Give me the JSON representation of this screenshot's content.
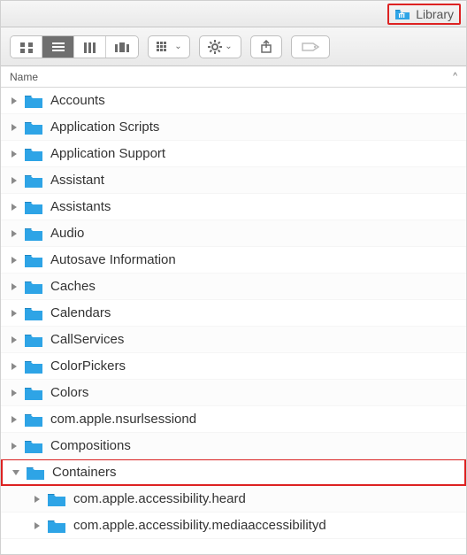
{
  "title": {
    "label": "Library",
    "icon": "library-folder-icon"
  },
  "toolbar": {
    "view_icon_label": "Icon View",
    "view_list_label": "List View",
    "view_column_label": "Column View",
    "view_coverflow_label": "Cover Flow View",
    "arrange_label": "Arrange",
    "action_label": "Action",
    "share_label": "Share",
    "tags_label": "Edit Tags"
  },
  "columns": {
    "name_label": "Name",
    "sort_indicator": "^"
  },
  "colors": {
    "folder": "#2ea4e6",
    "highlight": "#d22222",
    "toolbar_icon": "#6a6a6a",
    "active_bg": "#6f6f6f"
  },
  "rows": [
    {
      "label": "Accounts",
      "depth": 0,
      "expanded": false,
      "highlight": false
    },
    {
      "label": "Application Scripts",
      "depth": 0,
      "expanded": false,
      "highlight": false
    },
    {
      "label": "Application Support",
      "depth": 0,
      "expanded": false,
      "highlight": false
    },
    {
      "label": "Assistant",
      "depth": 0,
      "expanded": false,
      "highlight": false
    },
    {
      "label": "Assistants",
      "depth": 0,
      "expanded": false,
      "highlight": false
    },
    {
      "label": "Audio",
      "depth": 0,
      "expanded": false,
      "highlight": false
    },
    {
      "label": "Autosave Information",
      "depth": 0,
      "expanded": false,
      "highlight": false
    },
    {
      "label": "Caches",
      "depth": 0,
      "expanded": false,
      "highlight": false
    },
    {
      "label": "Calendars",
      "depth": 0,
      "expanded": false,
      "highlight": false
    },
    {
      "label": "CallServices",
      "depth": 0,
      "expanded": false,
      "highlight": false
    },
    {
      "label": "ColorPickers",
      "depth": 0,
      "expanded": false,
      "highlight": false
    },
    {
      "label": "Colors",
      "depth": 0,
      "expanded": false,
      "highlight": false
    },
    {
      "label": "com.apple.nsurlsessiond",
      "depth": 0,
      "expanded": false,
      "highlight": false
    },
    {
      "label": "Compositions",
      "depth": 0,
      "expanded": false,
      "highlight": false
    },
    {
      "label": "Containers",
      "depth": 0,
      "expanded": true,
      "highlight": true
    },
    {
      "label": "com.apple.accessibility.heard",
      "depth": 1,
      "expanded": false,
      "highlight": false
    },
    {
      "label": "com.apple.accessibility.mediaaccessibilityd",
      "depth": 1,
      "expanded": false,
      "highlight": false
    }
  ]
}
